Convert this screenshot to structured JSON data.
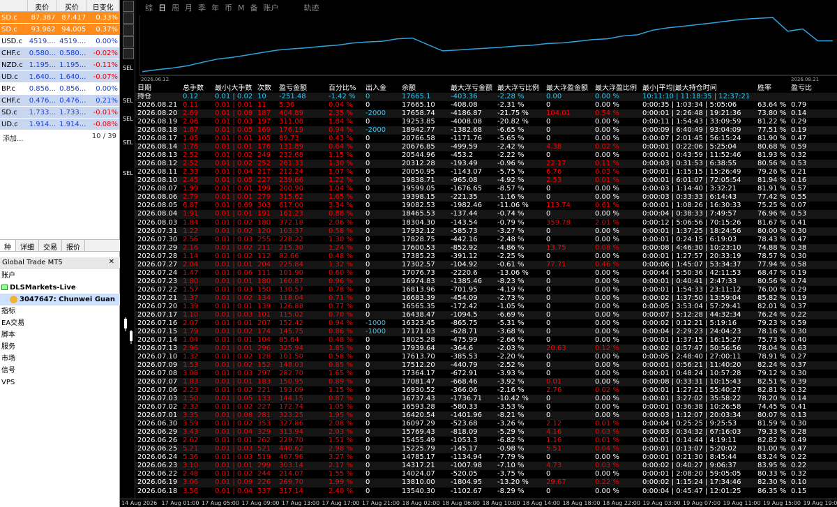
{
  "market_watch": {
    "headers": [
      "",
      "卖价",
      "买价",
      "日变化"
    ],
    "rows": [
      {
        "sym": "SD.c",
        "bid": "87.387",
        "ask": "87.417",
        "chg": "0.33%",
        "style": "orange"
      },
      {
        "sym": "SD.c",
        "bid": "93.962",
        "ask": "94.005",
        "chg": "0.37%",
        "style": "orange"
      },
      {
        "sym": "USD.c",
        "bid": "4519....",
        "ask": "4519....",
        "chg": "0.00%",
        "style": "white"
      },
      {
        "sym": "CHF.c",
        "bid": "0.580...",
        "ask": "0.580...",
        "chg": "-0.02%",
        "style": "blue"
      },
      {
        "sym": "NZD.c",
        "bid": "1.195...",
        "ask": "1.195...",
        "chg": "-0.11%",
        "style": "blue"
      },
      {
        "sym": "UD.c",
        "bid": "1.640...",
        "ask": "1.640...",
        "chg": "-0.07%",
        "style": "blue"
      },
      {
        "sym": "BP.c",
        "bid": "0.856...",
        "ask": "0.856...",
        "chg": "0.00%",
        "style": "white"
      },
      {
        "sym": "CHF.c",
        "bid": "0.476...",
        "ask": "0.476...",
        "chg": "0.21%",
        "style": "blue"
      },
      {
        "sym": "SD.c",
        "bid": "1.733...",
        "ask": "1.733...",
        "chg": "-0.01%",
        "style": "blue"
      },
      {
        "sym": "UD.c",
        "bid": "1.914...",
        "ask": "1.914...",
        "chg": "-0.08%",
        "style": "blue"
      }
    ],
    "footer_left": "添加...",
    "footer_right": "10 / 39",
    "tabs": [
      "种",
      "详细",
      "交易",
      "报价"
    ]
  },
  "navigator": {
    "title": "Global Trade MT5",
    "close": "✕",
    "items": [
      "账户",
      "DLSMarkets-Live",
      "3047647: Chunwei Guan",
      "指标",
      "EA交易",
      "脚本",
      "服务",
      "市场",
      "信号",
      "VPS"
    ]
  },
  "toolbar": {
    "items": [
      "综",
      "日",
      "周",
      "月",
      "季",
      "年",
      "币",
      "M",
      "备",
      "账户",
      "轨迹"
    ],
    "active": "日"
  },
  "chart": {
    "start_label": "2026.06.12",
    "end_label": "2026.08.21",
    "line_color": "#2fa3e0"
  },
  "table": {
    "headers": [
      "日期",
      "总手数",
      "最小|大手数",
      "次数",
      "盈亏金额",
      "百分比%",
      "出入金",
      "余额",
      "最大浮亏金额",
      "最大浮亏比例",
      "最大浮盈金额",
      "最大浮盈比例",
      "最小|平均|最大持仓时间",
      "胜率",
      "盈亏比"
    ],
    "summary": [
      "持仓",
      "0.12",
      "0.01 | 0.02",
      "10",
      "-251.48",
      "-1.42 %",
      "0",
      "17665.1",
      "-403.36",
      "-2.28 %",
      "0.00",
      "0.00 %",
      "10:11:10 | 11:18:35 | 12:37:21",
      "",
      ""
    ],
    "rows": [
      [
        "2026.08.21",
        "0.11",
        "0.01 | 0.01",
        "11",
        "5.36",
        "0.04 %",
        "0",
        "17665.10",
        "-408.08",
        "-2.31 %",
        "0",
        "0.00 %",
        "0:00:35 | 1:03:34 | 5:05:06",
        "63.64 %",
        "0.79"
      ],
      [
        "2026.08.20",
        "2.69",
        "0.01 | 0.09",
        "187",
        "404.89",
        "2.35 %",
        "-2000",
        "17658.74",
        "-4186.87",
        "-21.75 %",
        "104.01",
        "0.54 %",
        "0:00:01 | 2:26:48 | 19:21:36",
        "73.80 %",
        "0.14"
      ],
      [
        "2026.08.19",
        "2.06",
        "0.01 | 0.03",
        "197",
        "311.08",
        "1.84 %",
        "0",
        "19253.85",
        "-4008.08",
        "-20.82 %",
        "0",
        "0.00 %",
        "0:00:11 | 1:54:43 | 33:09:59",
        "81.22 %",
        "0.29"
      ],
      [
        "2026.08.18",
        "1.87",
        "0.01 | 0.05",
        "169",
        "176.19",
        "0.94 %",
        "-2000",
        "18942.77",
        "-1382.68",
        "-6.65 %",
        "0",
        "0.00 %",
        "0:00:09 | 6:40:49 | 93:04:09",
        "77.51 %",
        "0.19"
      ],
      [
        "2026.08.17",
        "1.05",
        "0.01 | 0.01",
        "105",
        "89.73",
        "0.43 %",
        "0",
        "20766.58",
        "-1171.76",
        "-5.65 %",
        "0",
        "0.00 %",
        "0:00:07 | 2:01:45 | 56:15:24",
        "81.90 %",
        "0.47"
      ],
      [
        "2026.08.14",
        "1.76",
        "0.01 | 0.01",
        "176",
        "131.89",
        "0.64 %",
        "0",
        "20676.85",
        "-499.59",
        "-2.42 %",
        "4.38",
        "0.02 %",
        "0:00:01 | 0:22:06 | 5:25:04",
        "80.68 %",
        "0.59"
      ],
      [
        "2026.08.13",
        "2.52",
        "0.01 | 0.02",
        "249",
        "232.68",
        "1.15 %",
        "0",
        "20544.96",
        "-453.2",
        "-2.22 %",
        "0",
        "0.00 %",
        "0:00:01 | 0:43:59 | 11:52:46",
        "81.93 %",
        "0.32"
      ],
      [
        "2026.08.12",
        "2.52",
        "0.01 | 0.02",
        "252",
        "261.33",
        "1.30 %",
        "0",
        "20312.28",
        "-193.49",
        "-0.96 %",
        "22.17",
        "0.11 %",
        "0:00:03 | 0:31:53 | 6:38:55",
        "80.56 %",
        "0.53"
      ],
      [
        "2026.08.11",
        "2.33",
        "0.01 | 0.04",
        "217",
        "212.24",
        "1.07 %",
        "0",
        "20050.95",
        "-1143.07",
        "-5.75 %",
        "6.76",
        "0.03 %",
        "0:00:01 | 1:15:15 | 15:26:49",
        "79.26 %",
        "0.21"
      ],
      [
        "2026.08.10",
        "2.45",
        "0.01 | 0.05",
        "227",
        "239.66",
        "1.22 %",
        "0",
        "19838.71",
        "-965.08",
        "-4.92 %",
        "2.53",
        "0.01 %",
        "0:00:01 | 6:01:07 | 72:05:54",
        "81.94 %",
        "0.16"
      ],
      [
        "2026.08.07",
        "1.99",
        "0.01 | 0.01",
        "199",
        "200.90",
        "1.04 %",
        "0",
        "19599.05",
        "-1676.65",
        "-8.57 %",
        "0",
        "0.00 %",
        "0:00:03 | 1:14:40 | 3:32:21",
        "81.91 %",
        "0.57"
      ],
      [
        "2026.08.06",
        "2.79",
        "0.01 | 0.01",
        "279",
        "315.62",
        "1.65 %",
        "0",
        "19398.15",
        "-221.35",
        "-1.16 %",
        "0",
        "0.00 %",
        "0:00:03 | 0:33:33 | 6:14:43",
        "77.42 %",
        "0.55"
      ],
      [
        "2026.08.05",
        "6.87",
        "0.01 | 0.69",
        "303",
        "617.00",
        "3.34 %",
        "0",
        "19082.53",
        "-1982.46",
        "-11.06 %",
        "113.74",
        "0.61 %",
        "0:00:01 | 1:08:26 | 16:30:33",
        "75.25 %",
        "0.07"
      ],
      [
        "2026.08.04",
        "1.91",
        "0.01 | 0.01",
        "191",
        "161.23",
        "0.88 %",
        "0",
        "18465.53",
        "-137.44",
        "-0.74 %",
        "0",
        "0.00 %",
        "0:00:04 | 0:38:33 | 7:49:57",
        "76.96 %",
        "0.53"
      ],
      [
        "2026.08.03",
        "1.84",
        "0.01 | 0.02",
        "180",
        "372.18",
        "2.06 %",
        "0",
        "18304.30",
        "-143.54",
        "-0.79 %",
        "359.78",
        "2.01 %",
        "0:00:12 | 5:06:56 | 70:15:26",
        "81.67 %",
        "0.41"
      ],
      [
        "2026.07.31",
        "1.22",
        "0.01 | 0.02",
        "120",
        "103.37",
        "0.58 %",
        "0",
        "17932.12",
        "-585.73",
        "-3.27 %",
        "0",
        "0.00 %",
        "0:00:01 | 1:37:25 | 18:24:56",
        "80.00 %",
        "0.30"
      ],
      [
        "2026.07.30",
        "2.56",
        "0.01 | 0.03",
        "255",
        "228.22",
        "1.30 %",
        "0",
        "17828.75",
        "-442.16",
        "-2.48 %",
        "0",
        "0.00 %",
        "0:00:01 | 0:24:15 | 6:19:03",
        "78.43 %",
        "0.47"
      ],
      [
        "2026.07.29",
        "2.16",
        "0.01 | 0.02",
        "211",
        "215.30",
        "1.24 %",
        "0",
        "17600.53",
        "-852.92",
        "-4.86 %",
        "13.75",
        "0.08 %",
        "0:00:08 | 4:46:30 | 10:23:10",
        "74.88 %",
        "0.38"
      ],
      [
        "2026.07.28",
        "1.14",
        "0.01 | 0.02",
        "112",
        "82.66",
        "0.48 %",
        "0",
        "17385.23",
        "-391.12",
        "-2.25 %",
        "0",
        "0.00 %",
        "0:00:01 | 1:27:57 | 20:33:19",
        "78.57 %",
        "0.30"
      ],
      [
        "2026.07.27",
        "2.04",
        "0.01 | 0.01",
        "204",
        "225.84",
        "1.32 %",
        "0",
        "17302.57",
        "-104.92",
        "-0.61 %",
        "77.71",
        "0.46 %",
        "0:00:06 | 1:45:07 | 53:34:37",
        "77.94 %",
        "0.58"
      ],
      [
        "2026.07.24",
        "1.47",
        "0.01 | 0.06",
        "111",
        "101.90",
        "0.60 %",
        "0",
        "17076.73",
        "-2220.6",
        "-13.06 %",
        "0",
        "0.00 %",
        "0:00:44 | 5:50:36 | 42:11:53",
        "68.47 %",
        "0.19"
      ],
      [
        "2026.07.23",
        "1.80",
        "0.01 | 0.01",
        "180",
        "160.87",
        "0.96 %",
        "0",
        "16974.83",
        "-1385.46",
        "-8.23 %",
        "0",
        "0.00 %",
        "0:00:01 | 0:40:41 | 2:47:33",
        "80.56 %",
        "0.74"
      ],
      [
        "2026.07.22",
        "1.57",
        "0.01 | 0.03",
        "150",
        "130.57",
        "0.78 %",
        "0",
        "16813.96",
        "-701.95",
        "-4.19 %",
        "0",
        "0.00 %",
        "0:00:01 | 1:54:33 | 23:11:12",
        "76.00 %",
        "0.29"
      ],
      [
        "2026.07.21",
        "1.37",
        "0.01 | 0.02",
        "134",
        "118.04",
        "0.71 %",
        "0",
        "16683.39",
        "-454.09",
        "-2.73 %",
        "0",
        "0.00 %",
        "0:00:02 | 1:37:50 | 13:59:04",
        "85.82 %",
        "0.19"
      ],
      [
        "2026.07.20",
        "1.39",
        "0.01 | 0.01",
        "139",
        "126.88",
        "0.77 %",
        "0",
        "16565.35",
        "-172.42",
        "-1.05 %",
        "0",
        "0.00 %",
        "0:00:05 | 3:53:04 | 57:29:41",
        "82.01 %",
        "0.37"
      ],
      [
        "2026.07.17",
        "1.10",
        "0.01 | 0.03",
        "101",
        "115.02",
        "0.70 %",
        "0",
        "16438.47",
        "-1094.5",
        "-6.69 %",
        "0",
        "0.00 %",
        "0:00:07 | 5:12:28 | 44:32:34",
        "76.24 %",
        "0.22"
      ],
      [
        "2026.07.16",
        "2.07",
        "0.01 | 0.01",
        "207",
        "152.42",
        "0.94 %",
        "-1000",
        "16323.45",
        "-865.75",
        "-5.31 %",
        "0",
        "0.00 %",
        "0:00:02 | 0:12:21 | 5:19:16",
        "79.23 %",
        "0.59"
      ],
      [
        "2026.07.15",
        "1.79",
        "0.01 | 0.02",
        "174",
        "145.75",
        "0.86 %",
        "-1000",
        "17171.03",
        "-628.71",
        "-3.68 %",
        "0",
        "0.00 %",
        "0:00:04 | 2:29:23 | 24:04:23",
        "78.16 %",
        "0.30"
      ],
      [
        "2026.07.14",
        "1.04",
        "0.01 | 0.01",
        "104",
        "85.64",
        "0.48 %",
        "0",
        "18025.28",
        "-475.99",
        "-2.66 %",
        "0",
        "0.00 %",
        "0:00:01 | 1:37:15 | 16:15:27",
        "75.73 %",
        "0.40"
      ],
      [
        "2026.07.13",
        "2.96",
        "0.01 | 0.01",
        "296",
        "325.94",
        "1.85 %",
        "0",
        "17939.64",
        "-364.6",
        "-2.03 %",
        "20.63",
        "0.12 %",
        "0:00:02 | 0:57:47 | 50:56:56",
        "78.04 %",
        "0.63"
      ],
      [
        "2026.07.10",
        "1.32",
        "0.01 | 0.02",
        "128",
        "101.50",
        "0.58 %",
        "0",
        "17613.70",
        "-385.53",
        "-2.20 %",
        "0",
        "0.00 %",
        "0:00:05 | 2:48:40 | 27:00:11",
        "78.91 %",
        "0.27"
      ],
      [
        "2026.07.09",
        "1.53",
        "0.01 | 0.02",
        "152",
        "148.03",
        "0.85 %",
        "0",
        "17512.20",
        "-440.79",
        "-2.52 %",
        "0",
        "0.00 %",
        "0:00:01 | 0:56:21 | 11:40:20",
        "82.24 %",
        "0.37"
      ],
      [
        "2026.07.08",
        "3.08",
        "0.01 | 0.03",
        "297",
        "282.70",
        "1.65 %",
        "0",
        "17364.17",
        "-672.91",
        "-3.93 %",
        "0",
        "0.00 %",
        "0:00:01 | 0:48:24 | 10:57:28",
        "79.12 %",
        "0.30"
      ],
      [
        "2026.07.07",
        "1.83",
        "0.01 | 0.01",
        "183",
        "150.95",
        "0.89 %",
        "0",
        "17081.47",
        "-668.46",
        "-3.92 %",
        "0.01",
        "0.00 %",
        "0:00:08 | 0:33:31 | 10:15:43",
        "82.51 %",
        "0.39"
      ],
      [
        "2026.07.06",
        "2.23",
        "0.01 | 0.02",
        "221",
        "193.09",
        "1.15 %",
        "0",
        "16930.52",
        "-366.06",
        "-2.16 %",
        "2.76",
        "0.02 %",
        "0:00:01 | 1:27:21 | 55:40:27",
        "82.81 %",
        "0.32"
      ],
      [
        "2026.07.03",
        "1.50",
        "0.01 | 0.05",
        "133",
        "144.15",
        "0.87 %",
        "0",
        "16737.43",
        "-1736.71",
        "-10.42 %",
        "0",
        "0.00 %",
        "0:00:01 | 3:27:02 | 35:58:22",
        "78.20 %",
        "0.14"
      ],
      [
        "2026.07.02",
        "2.32",
        "0.01 | 0.02",
        "227",
        "172.74",
        "1.05 %",
        "0",
        "16593.28",
        "-580.33",
        "-3.53 %",
        "0",
        "0.00 %",
        "0:00:01 | 0:36:38 | 10:26:58",
        "74.45 %",
        "0.41"
      ],
      [
        "2026.07.01",
        "3.35",
        "0.01 | 0.08",
        "281",
        "323.25",
        "1.95 %",
        "0",
        "16420.54",
        "-1401.96",
        "-8.21 %",
        "0",
        "0.00 %",
        "0:00:03 | 1:12:07 | 20:03:34",
        "80.07 %",
        "0.13"
      ],
      [
        "2026.06.30",
        "3.59",
        "0.01 | 0.02",
        "353",
        "327.86",
        "2.08 %",
        "0",
        "16097.29",
        "-523.68",
        "-3.26 %",
        "2.12",
        "0.01 %",
        "0:00:04 | 0:25:25 | 9:25:53",
        "81.59 %",
        "0.30"
      ],
      [
        "2026.06.29",
        "3.43",
        "0.01 | 0.04",
        "329",
        "313.94",
        "2.03 %",
        "0",
        "15769.43",
        "-818.09",
        "-5.29 %",
        "4.16",
        "0.03 %",
        "0:00:03 | 0:34:32 | 67:16:03",
        "79.33 %",
        "0.28"
      ],
      [
        "2026.06.26",
        "2.62",
        "0.01 | 0.01",
        "262",
        "229.70",
        "1.51 %",
        "0",
        "15455.49",
        "-1053.3",
        "-6.82 %",
        "1.16",
        "0.01 %",
        "0:00:01 | 0:14:44 | 4:19:11",
        "82.82 %",
        "0.49"
      ],
      [
        "2026.06.25",
        "5.21",
        "0.01 | 0.03",
        "521",
        "440.62",
        "2.98 %",
        "0",
        "15225.79",
        "-145.17",
        "-0.98 %",
        "5.51",
        "0.04 %",
        "0:00:01 | 0:13:07 | 5:20:02",
        "81.00 %",
        "0.47"
      ],
      [
        "2026.06.24",
        "5.36",
        "0.01 | 0.03",
        "519",
        "467.96",
        "3.27 %",
        "0",
        "14785.17",
        "-1134.94",
        "-7.79 %",
        "0",
        "0.00 %",
        "0:00:01 | 0:21:30 | 8:45:44",
        "83.24 %",
        "0.22"
      ],
      [
        "2026.06.23",
        "3.10",
        "0.01 | 0.01",
        "299",
        "303.14",
        "2.17 %",
        "0",
        "14317.21",
        "-1007.98",
        "-7.10 %",
        "4.73",
        "0.03 %",
        "0:00:02 | 0:40:27 | 9:06:37",
        "83.95 %",
        "0.22"
      ],
      [
        "2026.06.22",
        "2.48",
        "0.01 | 0.02",
        "244",
        "214.07",
        "1.55 %",
        "0",
        "14024.07",
        "-520.05",
        "-3.75 %",
        "0",
        "0.00 %",
        "0:00:01 | 2:08:20 | 59:05:05",
        "80.33 %",
        "0.32"
      ],
      [
        "2026.06.19",
        "3.06",
        "0.01 | 0.09",
        "226",
        "269.70",
        "1.99 %",
        "0",
        "13810.00",
        "-1804.95",
        "-13.20 %",
        "29.67",
        "0.22 %",
        "0:00:02 | 1:15:24 | 17:34:46",
        "82.30 %",
        "0.10"
      ],
      [
        "2026.06.18",
        "3.56",
        "0.01 | 0.04",
        "337",
        "317.14",
        "2.40 %",
        "0",
        "13540.30",
        "-1102.67",
        "-8.29 %",
        "0",
        "0.00 %",
        "0:00:04 | 0:45:47 | 12:01:25",
        "86.35 %",
        "0.15"
      ]
    ]
  },
  "time_axis": [
    "14 Aug 2026",
    "17 Aug 01:00",
    "17 Aug 05:00",
    "17 Aug 09:00",
    "17 Aug 13:00",
    "17 Aug 17:00",
    "17 Aug 21:00",
    "18 Aug 02:00",
    "18 Aug 06:00",
    "18 Aug 10:00",
    "18 Aug 14:00",
    "18 Aug 18:00",
    "18 Aug 22:00",
    "19 Aug 03:00",
    "19 Aug 07:00",
    "19 Aug 11:00",
    "19 Aug 15:00",
    "19 Aug 19:00"
  ],
  "side_labels": [
    "SEL",
    "SEL",
    "SEL",
    "SEL",
    "SEL"
  ]
}
